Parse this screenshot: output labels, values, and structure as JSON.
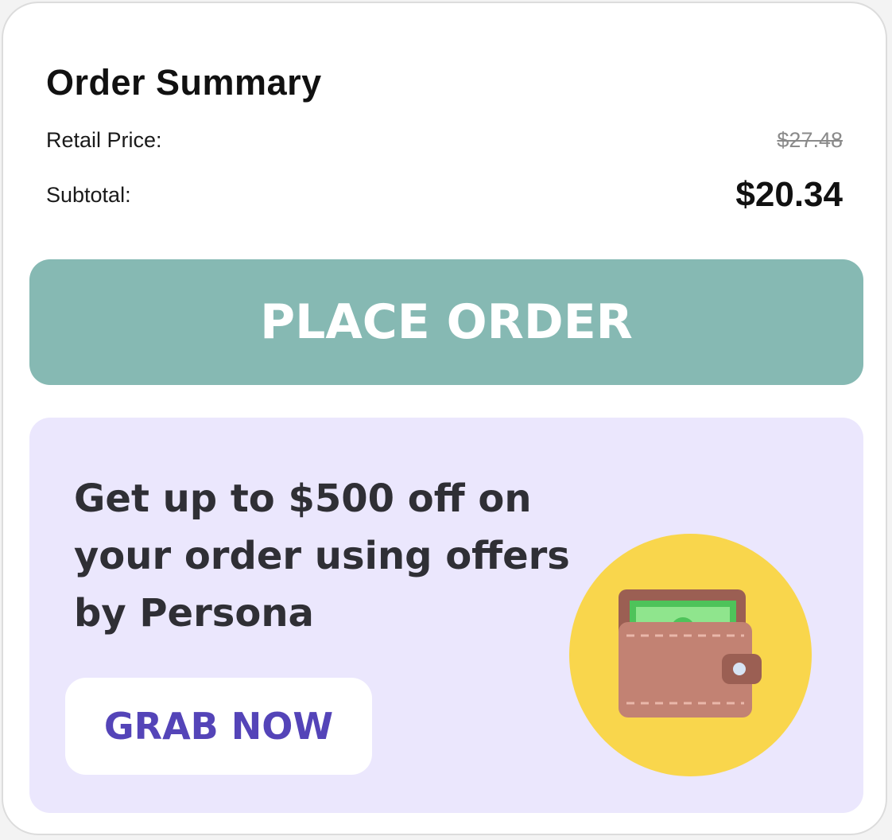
{
  "order_summary": {
    "title": "Order Summary",
    "retail_label": "Retail Price:",
    "retail_value": "$27.48",
    "subtotal_label": "Subtotal:",
    "subtotal_value": "$20.34"
  },
  "actions": {
    "place_order_label": "PLACE ORDER"
  },
  "promo": {
    "text": "Get up to $500 off on your order using offers by Persona",
    "cta_label": "GRAB NOW",
    "illustration_icon": "wallet-icon"
  },
  "colors": {
    "place_order_bg": "#86b9b3",
    "promo_bg": "#ebe7fd",
    "cta_text": "#5444b8",
    "coin_circle": "#f9d64c"
  }
}
